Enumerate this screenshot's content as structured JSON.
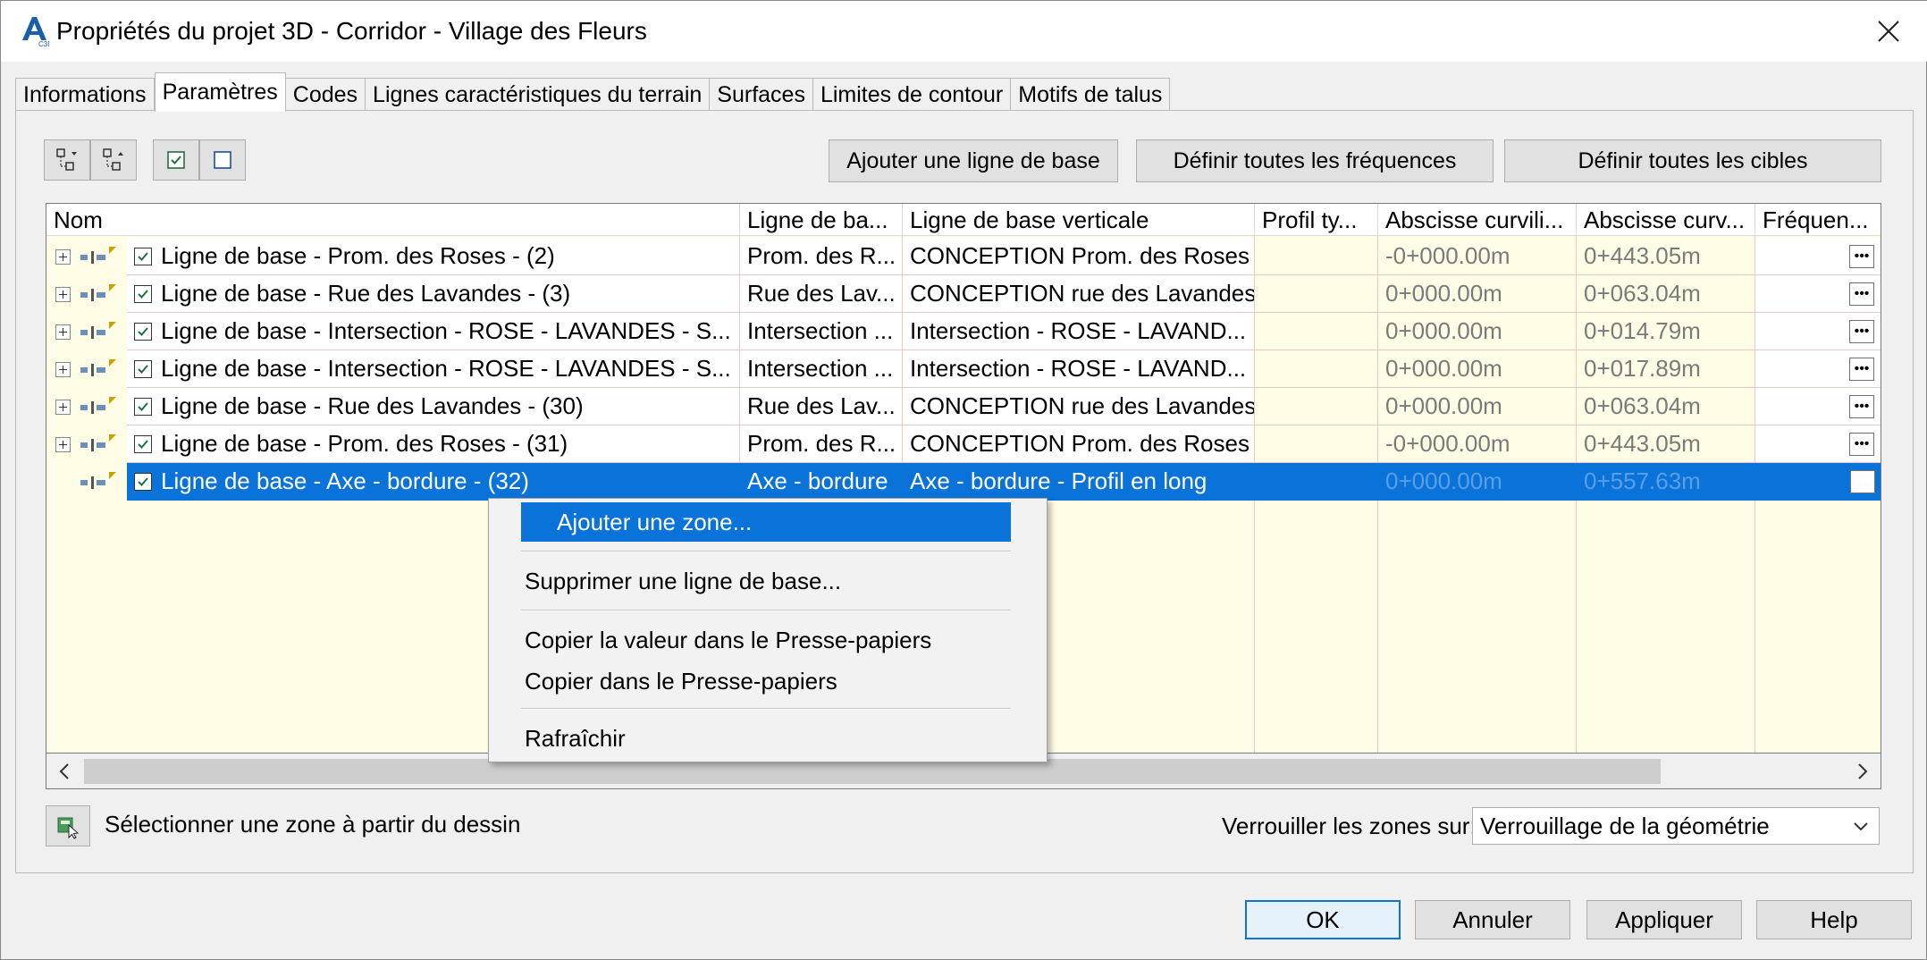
{
  "window": {
    "title": "Propriétés du projet 3D - Corridor - Village des Fleurs",
    "app_icon_letter": "A",
    "close_glyph": "✕"
  },
  "tabs": [
    {
      "label": "Informations",
      "active": false
    },
    {
      "label": "Paramètres",
      "active": true
    },
    {
      "label": "Codes",
      "active": false
    },
    {
      "label": "Lignes caractéristiques du terrain",
      "active": false
    },
    {
      "label": "Surfaces",
      "active": false
    },
    {
      "label": "Limites de contour",
      "active": false
    },
    {
      "label": "Motifs de talus",
      "active": false
    }
  ],
  "toolbar": {
    "add_baseline": "Ajouter une ligne de base",
    "set_all_frequencies": "Définir toutes les fréquences",
    "set_all_targets": "Définir toutes les cibles"
  },
  "columns": {
    "name": "Nom",
    "baseline": "Ligne de ba...",
    "vertical_baseline": "Ligne de base verticale",
    "typical_profile": "Profil ty...",
    "start_station": "Abscisse curvili...",
    "end_station": "Abscisse curv...",
    "frequency": "Fréquen..."
  },
  "rows": [
    {
      "name": "Ligne de base - Prom. des Roses - (2)",
      "baseline": "Prom. des R...",
      "vertical": "CONCEPTION Prom. des Roses",
      "start": "-0+000.00m",
      "end": "0+443.05m"
    },
    {
      "name": "Ligne de base - Rue des Lavandes - (3)",
      "baseline": "Rue des Lav...",
      "vertical": "CONCEPTION rue des Lavandes",
      "start": "0+000.00m",
      "end": "0+063.04m"
    },
    {
      "name": "Ligne de base - Intersection - ROSE - LAVANDES - S...",
      "baseline": "Intersection ...",
      "vertical": "Intersection - ROSE - LAVAND...",
      "start": "0+000.00m",
      "end": "0+014.79m"
    },
    {
      "name": "Ligne de base - Intersection - ROSE - LAVANDES - S...",
      "baseline": "Intersection ...",
      "vertical": "Intersection - ROSE - LAVAND...",
      "start": "0+000.00m",
      "end": "0+017.89m"
    },
    {
      "name": "Ligne de base - Rue des Lavandes - (30)",
      "baseline": "Rue des Lav...",
      "vertical": "CONCEPTION rue des Lavandes",
      "start": "0+000.00m",
      "end": "0+063.04m"
    },
    {
      "name": "Ligne de base - Prom. des Roses - (31)",
      "baseline": "Prom. des R...",
      "vertical": "CONCEPTION Prom. des Roses",
      "start": "-0+000.00m",
      "end": "0+443.05m"
    },
    {
      "name": "Ligne de base - Axe - bordure - (32)",
      "baseline": "Axe - bordure",
      "vertical": "Axe - bordure - Profil en long",
      "start": "0+000.00m",
      "end": "0+557.63m"
    }
  ],
  "context_menu": {
    "add_region": "Ajouter une zone...",
    "delete_baseline": "Supprimer une ligne de base...",
    "copy_value": "Copier la valeur dans le Presse-papiers",
    "copy_clipboard": "Copier dans le Presse-papiers",
    "refresh": "Rafraîchir"
  },
  "bottom": {
    "select_region_label": "Sélectionner une zone à partir du dessin",
    "lock_label": "Verrouiller les zones sur:",
    "lock_value": "Verrouillage de la géométrie"
  },
  "footer": {
    "ok": "OK",
    "cancel": "Annuler",
    "apply": "Appliquer",
    "help": "Help"
  },
  "glyphs": {
    "ellipsis": "•••",
    "scroll_left": "‹",
    "scroll_right": "›",
    "check": "✓"
  },
  "colors": {
    "selection": "#0a73d9",
    "column_fill": "#fffde6",
    "grid_line": "#f2c6c6"
  }
}
